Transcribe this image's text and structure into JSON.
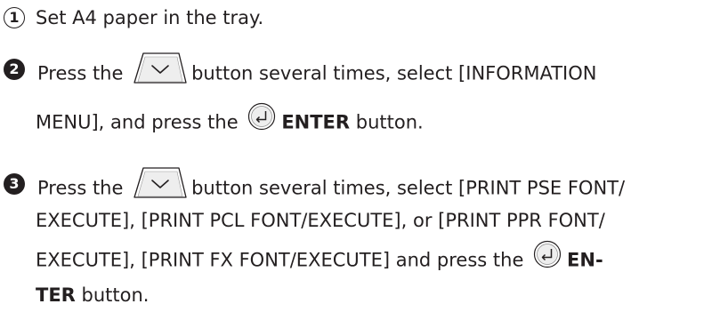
{
  "steps": [
    {
      "number": "1",
      "lines": [
        [
          "Set A4 paper in the tray."
        ]
      ]
    },
    {
      "number": "2",
      "lines": [
        [
          "Press the ",
          "button several times, select [INFORMATION"
        ],
        [
          "MENU], and press the ",
          "ENTER",
          " button."
        ]
      ]
    },
    {
      "number": "3",
      "lines": [
        [
          "Press the ",
          "button several times, select [PRINT PSE FONT/"
        ],
        [
          "EXECUTE], [PRINT PCL FONT/EXECUTE], or [PRINT PPR FONT/"
        ],
        [
          "EXECUTE], [PRINT FX FONT/EXECUTE] and press the ",
          "EN-"
        ],
        [
          "TER",
          " button."
        ]
      ]
    }
  ],
  "icons": {
    "down_arrow": "down-arrow-button-icon",
    "enter": "enter-button-icon"
  }
}
